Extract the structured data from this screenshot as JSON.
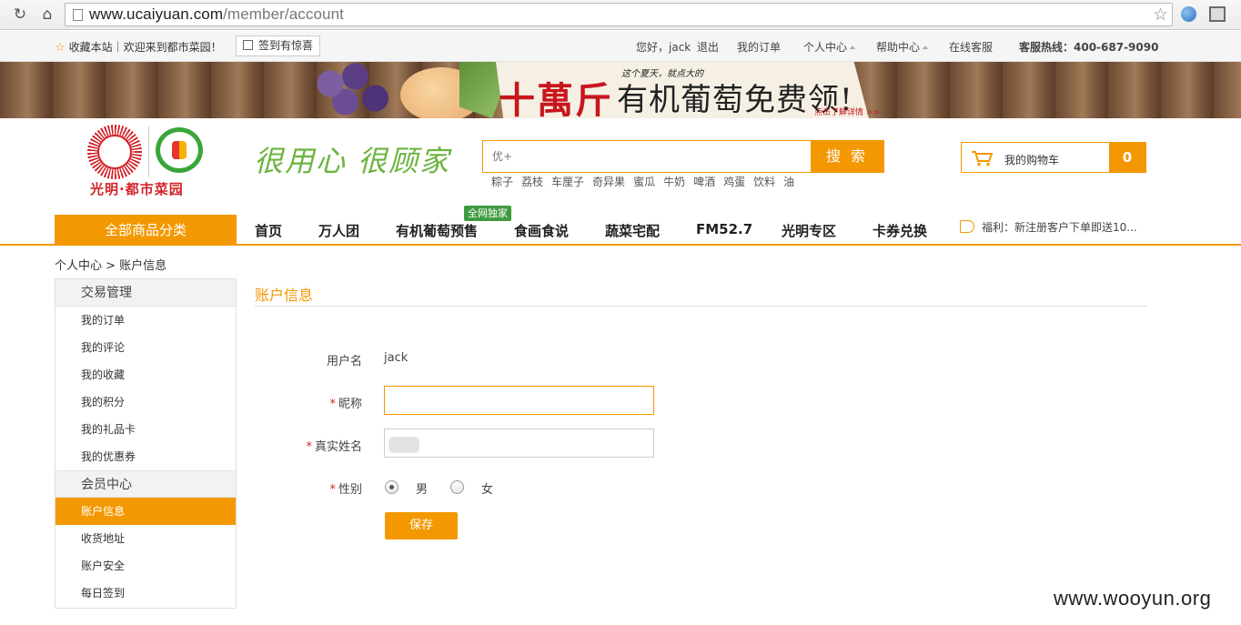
{
  "browser": {
    "url_host": "www.ucaiyuan.com",
    "url_path": "/member/account"
  },
  "topbar": {
    "favorite": "收藏本站｜欢迎来到都市菜园！",
    "signin": "签到有惊喜",
    "greeting": "您好，jack",
    "logout": "退出",
    "my_orders": "我的订单",
    "personal_center": "个人中心",
    "help_center": "帮助中心",
    "online_service": "在线客服",
    "hotline": "客服热线：400-687-9090"
  },
  "banner": {
    "tagline": "这个夏天，就点大的",
    "headline_big": "十萬斤",
    "headline_rest": "有机葡萄免费领!",
    "more": "点击了解详情 >>"
  },
  "header": {
    "logo_text": "光明·都市菜园",
    "slogan": "很用心 很顾家",
    "search_placeholder": "优+",
    "search_button": "搜 索",
    "hot_words": [
      "粽子",
      "荔枝",
      "车厘子",
      "奇异果",
      "蜜瓜",
      "牛奶",
      "啤酒",
      "鸡蛋",
      "饮料",
      "油"
    ],
    "cart_label": "我的购物车",
    "cart_count": "0"
  },
  "nav": {
    "all_categories": "全部商品分类",
    "items": [
      "首页",
      "万人团",
      "有机葡萄预售",
      "食画食说",
      "蔬菜宅配",
      "FM52.7",
      "光明专区",
      "卡券兑换"
    ],
    "badge": "全网独家",
    "notice": "福利：新注册客户下单即送10..."
  },
  "breadcrumb": "个人中心 > 账户信息",
  "sidebar": {
    "groups": [
      {
        "title": "交易管理",
        "items": [
          "我的订单",
          "我的评论",
          "我的收藏",
          "我的积分",
          "我的礼品卡",
          "我的优惠券"
        ]
      },
      {
        "title": "会员中心",
        "items": [
          "账户信息",
          "收货地址",
          "账户安全",
          "每日签到"
        ]
      }
    ],
    "active": "账户信息"
  },
  "form": {
    "title": "账户信息",
    "username_label": "用户名",
    "username_value": "jack",
    "nickname_label": "昵称",
    "nickname_value": "",
    "realname_label": "真实姓名",
    "gender_label": "性别",
    "gender_male": "男",
    "gender_female": "女",
    "gender_selected": "男",
    "required_mark": "*",
    "save": "保存"
  },
  "watermark": "www.wooyun.org",
  "colors": {
    "accent": "#f39800",
    "brand_red": "#d2252b",
    "brand_green": "#6cb33f"
  }
}
